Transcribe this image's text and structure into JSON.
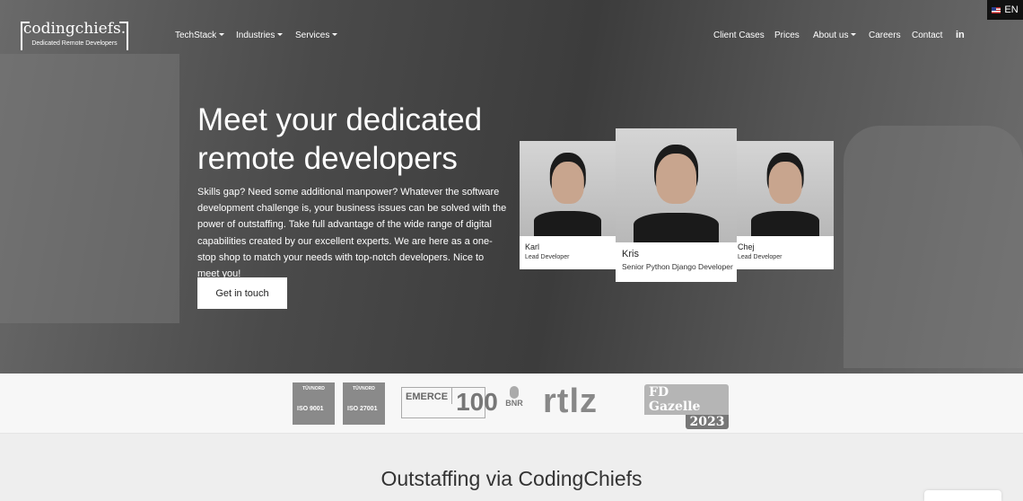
{
  "language": {
    "label": "EN",
    "icon": "us-flag-icon"
  },
  "logo": {
    "name": "codingchiefs.",
    "tagline": "Dedicated Remote Developers"
  },
  "nav": {
    "left": [
      {
        "label": "TechStack",
        "dropdown": true
      },
      {
        "label": "Industries",
        "dropdown": true
      },
      {
        "label": "Services",
        "dropdown": true
      }
    ],
    "right": [
      {
        "label": "Client Cases"
      },
      {
        "label": "Prices"
      },
      {
        "label": "About us",
        "dropdown": true
      },
      {
        "label": "Careers"
      },
      {
        "label": "Contact"
      }
    ],
    "social_icon": "linkedin-icon",
    "social_label": "in"
  },
  "hero": {
    "title_line1": "Meet your dedicated",
    "title_line2": "remote developers",
    "text": "Skills gap? Need some additional manpower? Whatever the software development challenge is, your business issues can be solved with the power of outstaffing. Take full advantage of the wide range of digital capabilities created by our excellent experts. We are here as a one-stop shop to match your needs with top-notch developers. Nice to meet you!",
    "cta": "Get in touch"
  },
  "developers": [
    {
      "name": "Karl",
      "role": "Lead Developer"
    },
    {
      "name": "Kris",
      "role": "Senior Python Django Developer"
    },
    {
      "name": "Chej",
      "role": "Lead Developer"
    }
  ],
  "badges": [
    {
      "top": "TÜVNORD",
      "label": "ISO 9001"
    },
    {
      "top": "TÜVNORD",
      "label": "ISO 27001"
    },
    {
      "label": "EMERCE",
      "value": "100"
    },
    {
      "label": "BNR"
    },
    {
      "label": "rtlz"
    },
    {
      "label": "FD Gazelle",
      "value": "2023"
    }
  ],
  "section": {
    "title": "Outstaffing via CodingChiefs"
  }
}
